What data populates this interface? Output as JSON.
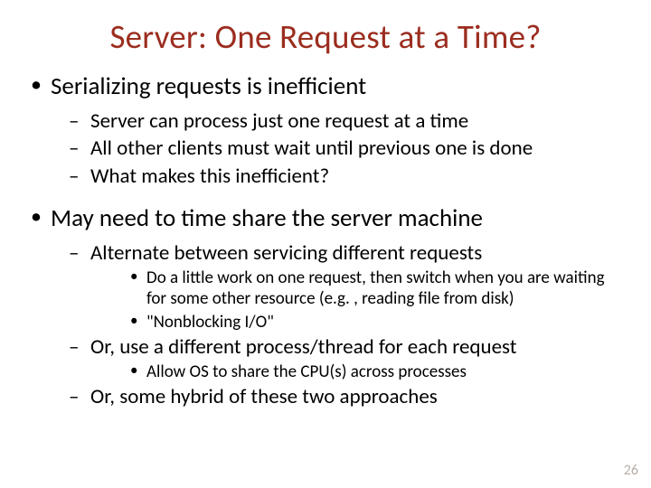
{
  "title": "Server: One Request at a Time?",
  "bullets": {
    "b1": "Serializing requests is inefficient",
    "b1_1": "Server can process just one request at a time",
    "b1_2": "All other clients must wait until previous one is done",
    "b1_3": "What makes this inefficient?",
    "b2": "May need to time share the server machine",
    "b2_1": "Alternate between servicing different requests",
    "b2_1_1": "Do a little work on one request, then switch when you are waiting for some other resource (e.g. , reading file from disk)",
    "b2_1_2": "\"Nonblocking I/O\"",
    "b2_2": "Or, use a different process/thread for each request",
    "b2_2_1": "Allow OS to share the CPU(s) across processes",
    "b2_3": "Or, some hybrid of these two approaches"
  },
  "page_number": "26"
}
